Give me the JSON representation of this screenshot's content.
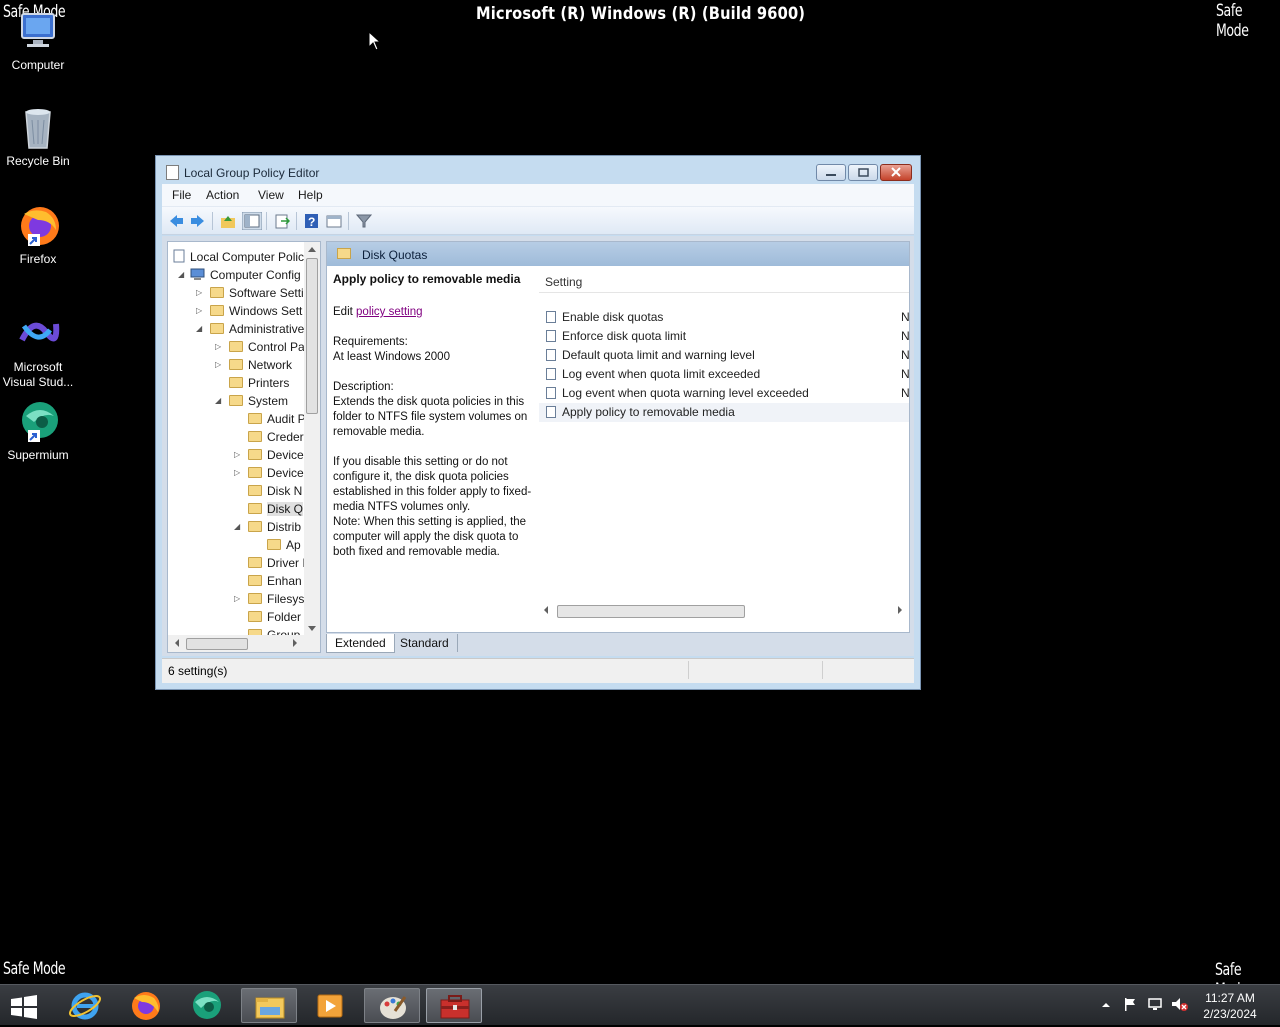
{
  "banner": {
    "safe_mode_tl": "Safe Mode",
    "safe_mode_tr": "Safe Mode",
    "safe_mode_bl": "Safe Mode",
    "safe_mode_br": "Safe Mode",
    "build": "Microsoft (R) Windows (R) (Build 9600)"
  },
  "desktop": {
    "icons": [
      {
        "label": "Computer",
        "icon": "computer-icon"
      },
      {
        "label": "Recycle Bin",
        "icon": "recycle-bin-icon"
      },
      {
        "label": "Firefox",
        "icon": "firefox-icon"
      },
      {
        "label": "Microsoft Visual Stud...",
        "icon": "visual-studio-icon"
      },
      {
        "label": "Supermium",
        "icon": "supermium-icon"
      }
    ]
  },
  "window": {
    "title": "Local Group Policy Editor",
    "menu": [
      "File",
      "Action",
      "View",
      "Help"
    ],
    "tree": [
      {
        "label": "Local Computer Polic",
        "expander": ""
      },
      {
        "label": "Computer Config",
        "expander": "◢"
      },
      {
        "label": "Software Setti",
        "expander": "▷"
      },
      {
        "label": "Windows Sett",
        "expander": "▷"
      },
      {
        "label": "Administrative",
        "expander": "◢"
      },
      {
        "label": "Control Pa",
        "expander": "▷"
      },
      {
        "label": "Network",
        "expander": "▷"
      },
      {
        "label": "Printers",
        "expander": ""
      },
      {
        "label": "System",
        "expander": "◢"
      },
      {
        "label": "Audit P",
        "expander": ""
      },
      {
        "label": "Creder",
        "expander": ""
      },
      {
        "label": "Device",
        "expander": "▷"
      },
      {
        "label": "Device",
        "expander": "▷"
      },
      {
        "label": "Disk N",
        "expander": ""
      },
      {
        "label": "Disk Q",
        "expander": ""
      },
      {
        "label": "Distrib",
        "expander": "◢"
      },
      {
        "label": "Ap",
        "expander": ""
      },
      {
        "label": "Driver I",
        "expander": ""
      },
      {
        "label": "Enhan",
        "expander": ""
      },
      {
        "label": "Filesys",
        "expander": "▷"
      },
      {
        "label": "Folder",
        "expander": ""
      },
      {
        "label": "Group",
        "expander": ""
      }
    ],
    "right_header": "Disk Quotas",
    "description": {
      "title": "Apply policy to removable media",
      "edit_prefix": "Edit",
      "edit_link": "policy setting",
      "req_label": "Requirements:",
      "req_value": "At least Windows 2000",
      "desc_label": "Description:",
      "desc_p1": "Extends the disk quota policies in this folder to NTFS file system volumes on removable media.",
      "desc_p2": "If you disable this setting or do not configure it, the disk quota policies established in this folder apply to fixed-media NTFS volumes only.",
      "desc_p3": "Note: When this setting is applied, the computer will apply the disk quota to both fixed and removable media."
    },
    "list": {
      "column": "Setting",
      "rows": [
        {
          "name": "Enable disk quotas",
          "state": "N"
        },
        {
          "name": "Enforce disk quota limit",
          "state": "N"
        },
        {
          "name": "Default quota limit and warning level",
          "state": "N"
        },
        {
          "name": "Log event when quota limit exceeded",
          "state": "N"
        },
        {
          "name": "Log event when quota warning level exceeded",
          "state": "N"
        },
        {
          "name": "Apply policy to removable media",
          "state": ""
        }
      ]
    },
    "tabs": [
      "Extended",
      "Standard"
    ],
    "status": "6 setting(s)"
  },
  "taskbar": {
    "time": "11:27 AM",
    "date": "2/23/2024"
  }
}
